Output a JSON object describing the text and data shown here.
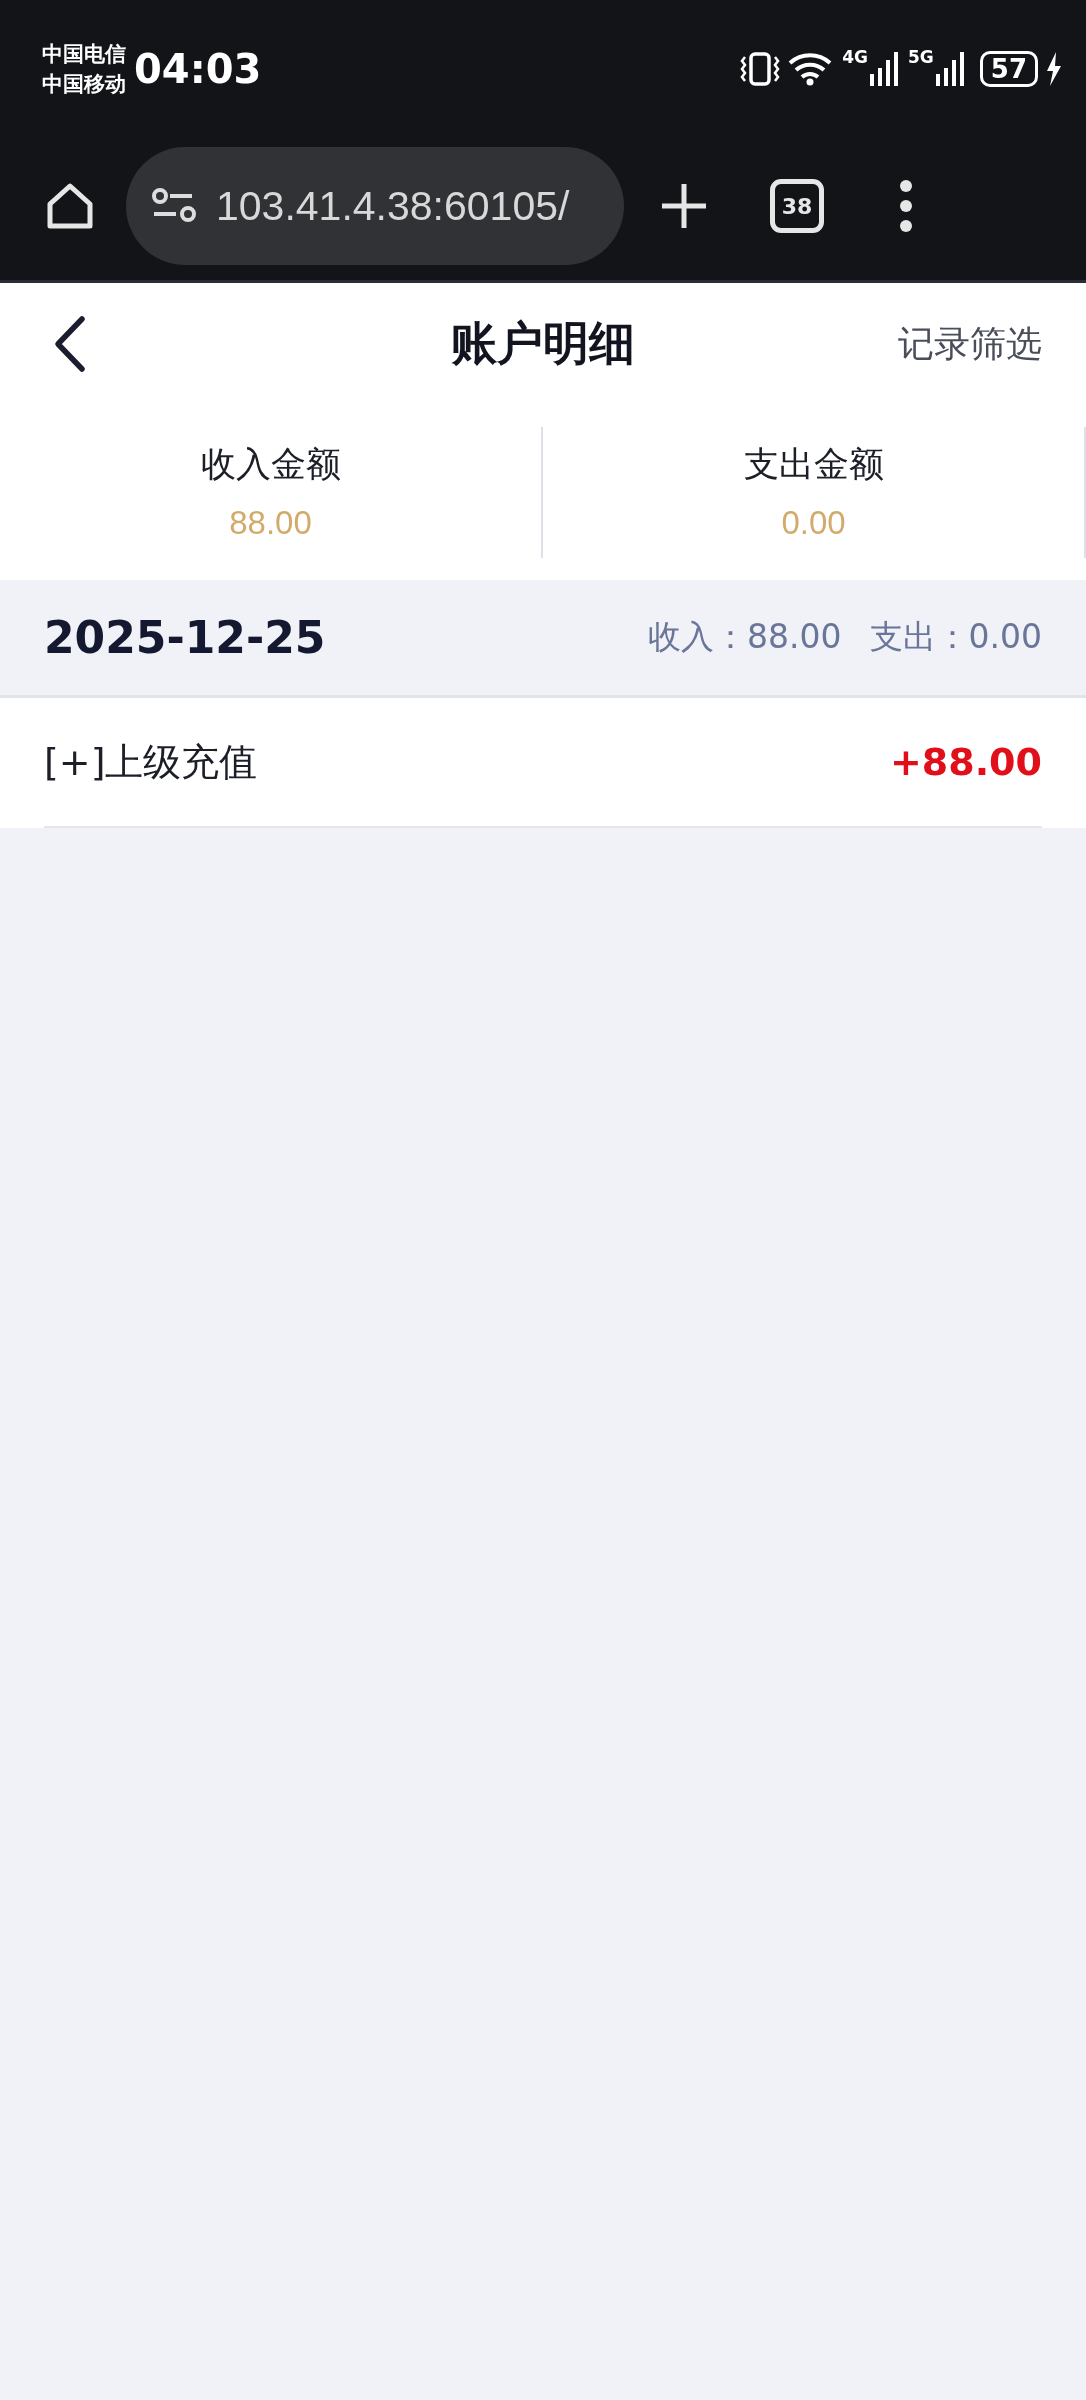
{
  "status_bar": {
    "carriers": [
      "中国电信",
      "中国移动"
    ],
    "time": "04:03",
    "net_4g": "4G",
    "net_5g": "5G",
    "battery": "57"
  },
  "browser": {
    "url": "103.41.4.38:60105/",
    "tab_count": "38"
  },
  "header": {
    "title": "账户明细",
    "action": "记录筛选"
  },
  "summary": [
    {
      "label": "收入金额",
      "value": "88.00"
    },
    {
      "label": "支出金额",
      "value": "0.00"
    }
  ],
  "groups": [
    {
      "date": "2025-12-25",
      "income": "收入：88.00",
      "expense": "支出：0.00",
      "entries": [
        {
          "title": "[+]上级充值",
          "amount": "+88.00",
          "kind": "income"
        }
      ]
    }
  ]
}
